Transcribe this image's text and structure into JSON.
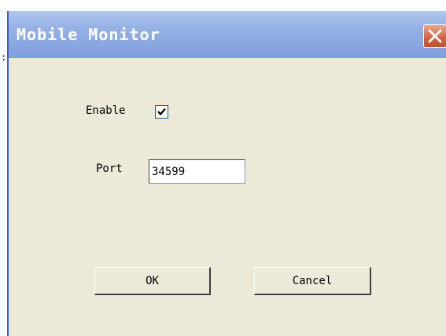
{
  "stray_text": ":",
  "window": {
    "title": "Mobile Monitor",
    "close_icon": "close-icon"
  },
  "form": {
    "enable_label": "Enable",
    "enable_checked": true,
    "port_label": "Port",
    "port_value": "34599"
  },
  "buttons": {
    "ok_label": "OK",
    "cancel_label": "Cancel"
  },
  "colors": {
    "titlebar": "#96b1e5",
    "close_button": "#d3603e",
    "dialog_background": "#ece9d8"
  }
}
